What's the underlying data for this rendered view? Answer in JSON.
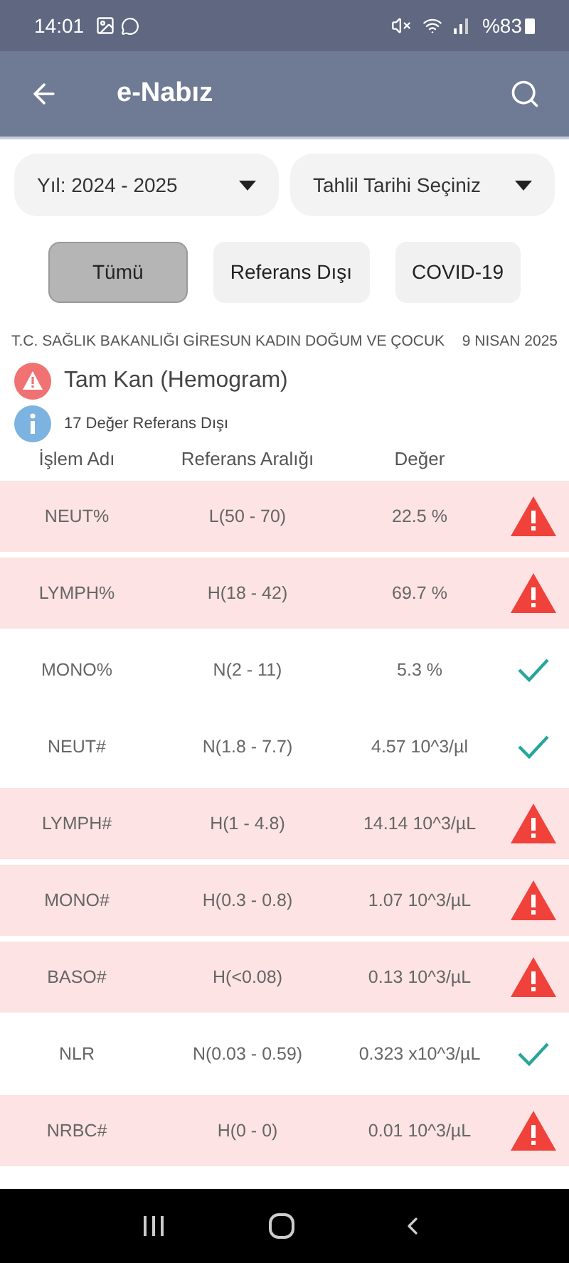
{
  "status_bar": {
    "time": "14:01",
    "battery": "%83"
  },
  "app_bar": {
    "title": "e-Nabız"
  },
  "filters": [
    {
      "label": "Yıl: 2024 - 2025"
    },
    {
      "label": "Tahlil Tarihi Seçiniz"
    }
  ],
  "tabs": [
    {
      "label": "Tümü",
      "selected": true
    },
    {
      "label": "Referans Dışı",
      "selected": false
    },
    {
      "label": "COVID-19",
      "selected": false
    }
  ],
  "report": {
    "institution": "T.C. SAĞLIK BAKANLIĞI GİRESUN KADIN DOĞUM VE ÇOCUK",
    "date": "9 NISAN 2025",
    "test_name": "Tam Kan (Hemogram)",
    "summary": "17 Değer Referans Dışı"
  },
  "table": {
    "columns": [
      "İşlem Adı",
      "Referans Aralığı",
      "Değer"
    ],
    "rows": [
      {
        "name": "NEUT%",
        "range": "L(50 - 70)",
        "value": "22.5 %",
        "abnormal": true
      },
      {
        "name": "LYMPH%",
        "range": "H(18 - 42)",
        "value": "69.7 %",
        "abnormal": true
      },
      {
        "name": "MONO%",
        "range": "N(2 - 11)",
        "value": "5.3 %",
        "abnormal": false
      },
      {
        "name": "NEUT#",
        "range": "N(1.8 - 7.7)",
        "value": "4.57 10^3/µl",
        "abnormal": false
      },
      {
        "name": "LYMPH#",
        "range": "H(1 - 4.8)",
        "value": "14.14 10^3/µL",
        "abnormal": true
      },
      {
        "name": "MONO#",
        "range": "H(0.3 - 0.8)",
        "value": "1.07 10^3/µL",
        "abnormal": true
      },
      {
        "name": "BASO#",
        "range": "H(<0.08)",
        "value": "0.13 10^3/µL",
        "abnormal": true
      },
      {
        "name": "NLR",
        "range": "N(0.03 - 0.59)",
        "value": "0.323 x10^3/µL",
        "abnormal": false
      },
      {
        "name": "NRBC#",
        "range": "H(0 - 0)",
        "value": "0.01 10^3/µL",
        "abnormal": true
      }
    ]
  }
}
